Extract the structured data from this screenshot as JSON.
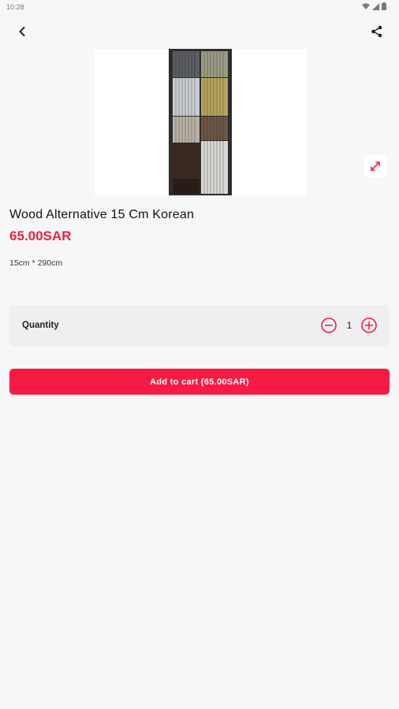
{
  "status_bar": {
    "time": "10:28",
    "icons": [
      "wifi-icon",
      "signal-icon",
      "battery-icon"
    ]
  },
  "app_bar": {
    "back_icon": "chevron-left-icon",
    "share_icon": "share-icon"
  },
  "product": {
    "image_icon": "expand-icon",
    "title": "Wood Alternative 15 Cm Korean",
    "price": "65.00SAR",
    "description": "15cm * 290cm"
  },
  "quantity": {
    "label": "Quantity",
    "value": "1",
    "minus_icon": "minus-circle-icon",
    "plus_icon": "plus-circle-icon"
  },
  "cart_button": {
    "label": "Add to cart (65.00SAR)"
  },
  "colors": {
    "accent": "#f71a45",
    "price": "#f2203f",
    "background": "#f7f7f7"
  }
}
